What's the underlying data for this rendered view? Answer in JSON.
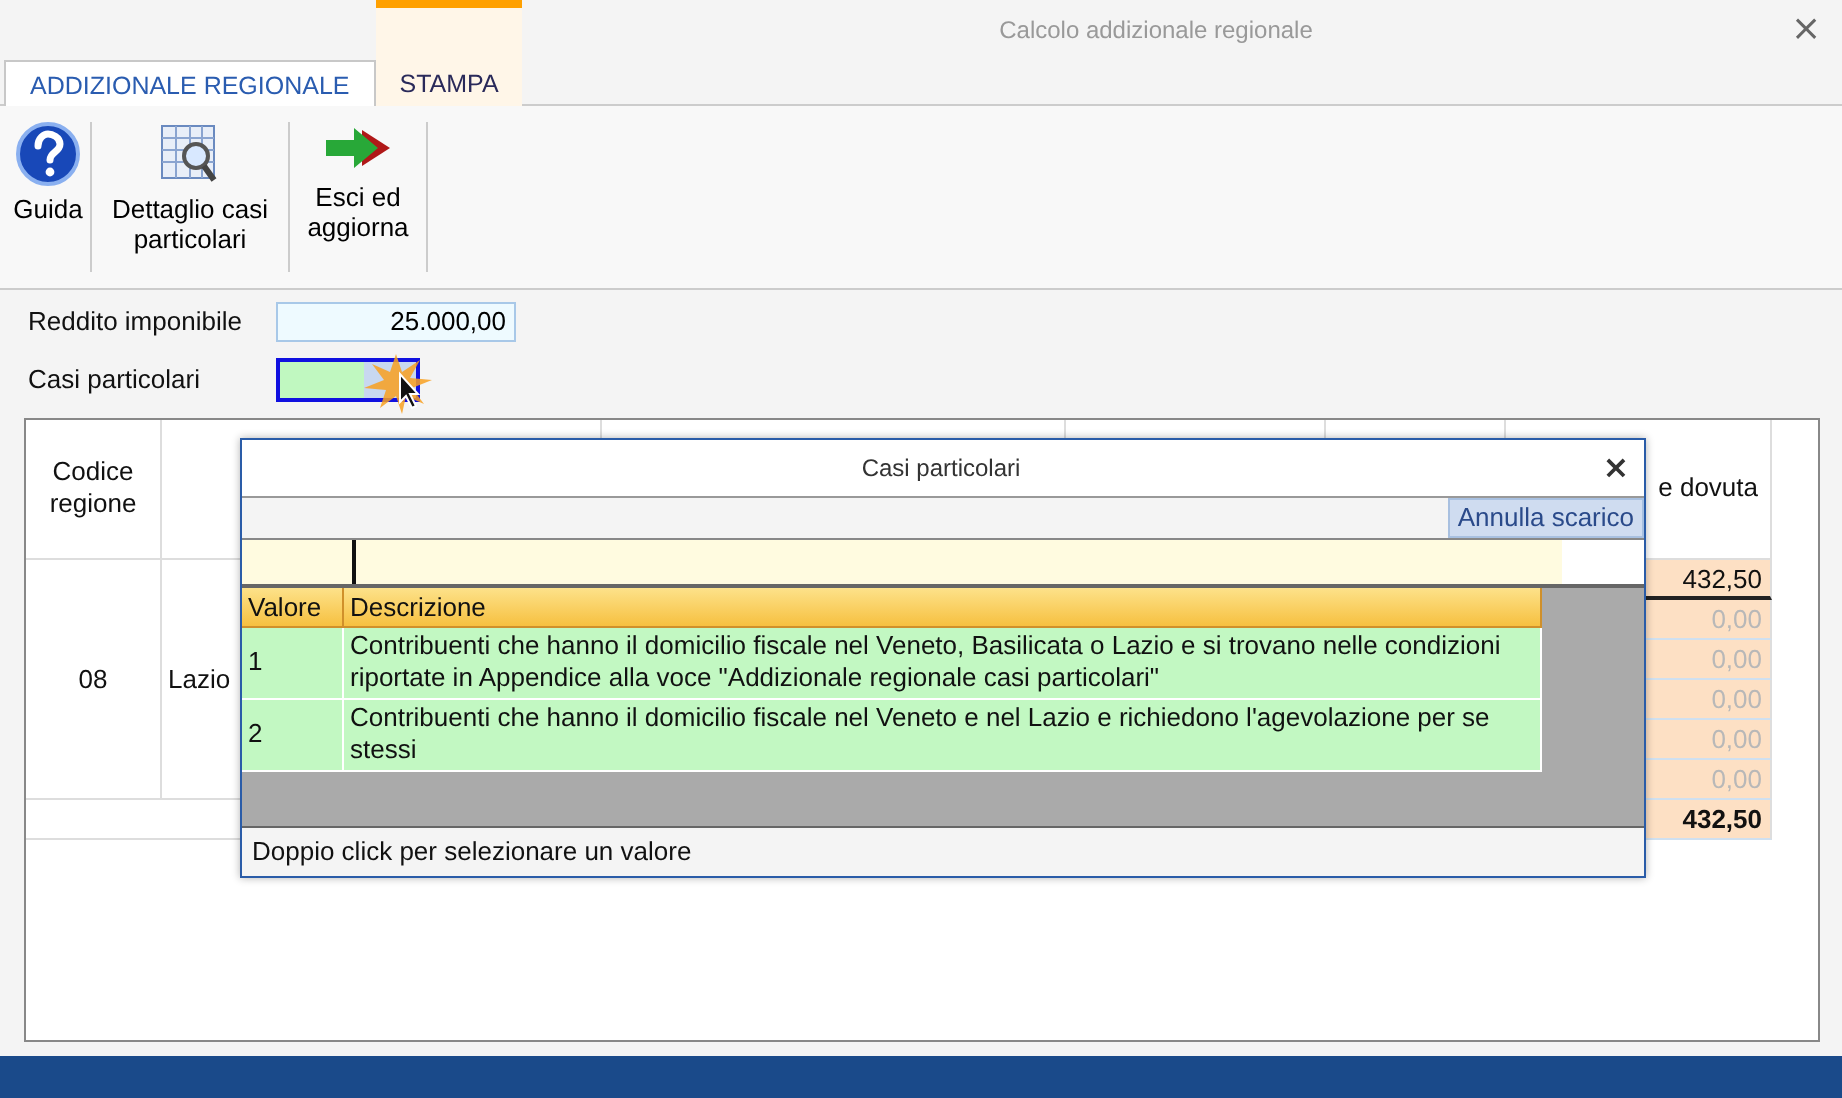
{
  "window": {
    "title": "Calcolo addizionale regionale",
    "close": "×"
  },
  "tabs": [
    {
      "label": "ADDIZIONALE REGIONALE",
      "selected": true,
      "highlighted": false
    },
    {
      "label": "STAMPA",
      "selected": false,
      "highlighted": true
    }
  ],
  "toolbar": [
    {
      "kind": "help",
      "label": "Guida"
    },
    {
      "kind": "detail",
      "label": "Dettaglio casi particolari"
    },
    {
      "kind": "exit",
      "label": "Esci ed aggiorna"
    }
  ],
  "form": {
    "income": {
      "label": "Reddito imponibile",
      "value": "25.000,00"
    },
    "special_cases": {
      "label": "Casi particolari",
      "focused": true
    }
  },
  "table": {
    "header": {
      "column_1": "Codice regione",
      "column_6": "e dovuta"
    },
    "row": {
      "code": "08",
      "region": "Lazio",
      "amounts": [
        {
          "value": "432,50",
          "disabled": false
        },
        {
          "value": "0,00",
          "disabled": true
        },
        {
          "value": "0,00",
          "disabled": true
        },
        {
          "value": "0,00",
          "disabled": true
        },
        {
          "value": "0,00",
          "disabled": true
        },
        {
          "value": "0,00",
          "disabled": true
        }
      ],
      "total": "432,50"
    }
  },
  "popup": {
    "title": "Casi particolari",
    "close": "×",
    "action": "Annulla scarico",
    "columns": [
      "Valore",
      "Descrizione"
    ],
    "rows": [
      {
        "value": "1",
        "description": "Contribuenti che hanno il domicilio fiscale nel Veneto, Basilicata o Lazio e si trovano nelle condizioni riportate in Appendice alla voce \"Addizionale regionale casi particolari\""
      },
      {
        "value": "2",
        "description": "Contribuenti che hanno il domicilio fiscale nel Veneto e nel Lazio e richiedono l'agevolazione per se stessi"
      }
    ],
    "footer": "Doppio click per selezionare un valore"
  }
}
